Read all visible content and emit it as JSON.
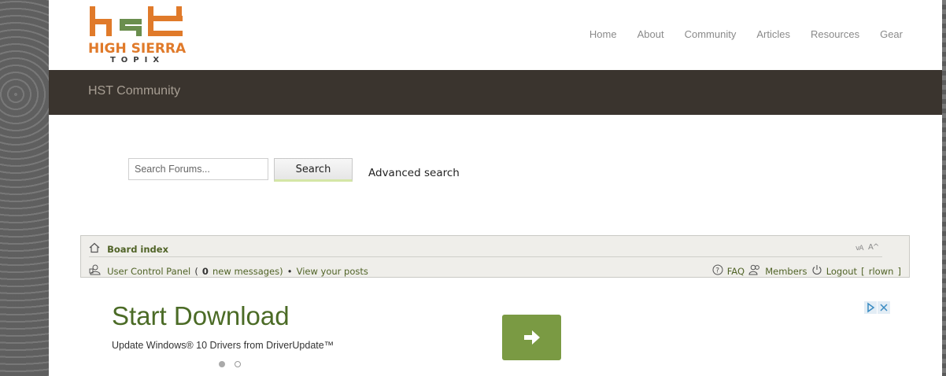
{
  "site": {
    "logo_line1": "HIGH SIERRA",
    "logo_line2": "TOPIX",
    "logo_mark": "hst"
  },
  "nav": {
    "items": [
      "Home",
      "About",
      "Community",
      "Articles",
      "Resources",
      "Gear"
    ]
  },
  "title_bar": {
    "title": "HST Community"
  },
  "search": {
    "placeholder": "Search Forums...",
    "button_label": "Search",
    "advanced_label": "Advanced search"
  },
  "forum_nav": {
    "board_index": "Board index",
    "font_size_icon": "font-size-icon",
    "ucp_label": "User Control Panel",
    "ucp_open": "(",
    "new_messages_count": "0",
    "new_messages_label": "new messages)",
    "bullet": "•",
    "view_posts": "View your posts",
    "faq": "FAQ",
    "members": "Members",
    "logout": "Logout",
    "username_open": "[",
    "username": "rlown",
    "username_close": "]"
  },
  "ad": {
    "title": "Start Download",
    "subtitle": "Update Windows® 10 Drivers from DriverUpdate™",
    "button_icon": "arrow-right-icon",
    "active_dot": 0,
    "dot_count": 2
  },
  "colors": {
    "title_bar_bg": "#3a342e",
    "logo_orange": "#e07a2a",
    "link_green": "#506327",
    "ad_button": "#7a9a43",
    "ad_title": "#4b6b26"
  }
}
